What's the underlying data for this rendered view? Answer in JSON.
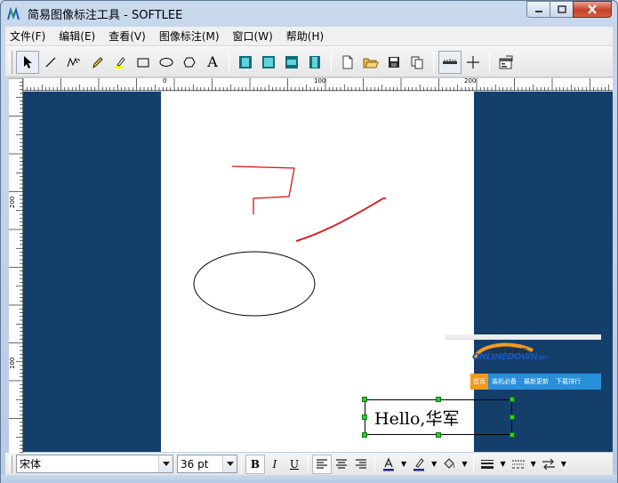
{
  "window": {
    "title": "简易图像标注工具 - SOFTLEE",
    "buttons": {
      "minimize": "minimize",
      "maximize": "maximize",
      "close": "close"
    }
  },
  "menubar": {
    "items": [
      {
        "label": "文件(F)"
      },
      {
        "label": "编辑(E)"
      },
      {
        "label": "查看(V)"
      },
      {
        "label": "图像标注(M)"
      },
      {
        "label": "窗口(W)"
      },
      {
        "label": "帮助(H)"
      }
    ]
  },
  "toolbar": {
    "tools": [
      {
        "name": "select-arrow-icon"
      },
      {
        "name": "line-icon"
      },
      {
        "name": "freehand-icon"
      },
      {
        "name": "pencil-icon"
      },
      {
        "name": "highlighter-icon"
      },
      {
        "name": "rectangle-icon"
      },
      {
        "name": "ellipse-icon"
      },
      {
        "name": "polygon-icon"
      },
      {
        "name": "text-icon",
        "label": "A"
      },
      {
        "name": "frame-style-1-icon"
      },
      {
        "name": "frame-style-2-icon"
      },
      {
        "name": "frame-style-3-icon"
      },
      {
        "name": "frame-style-4-icon"
      },
      {
        "name": "new-file-icon"
      },
      {
        "name": "open-folder-icon"
      },
      {
        "name": "save-icon"
      },
      {
        "name": "copy-icon"
      },
      {
        "name": "ruler-icon"
      },
      {
        "name": "crosshair-icon"
      },
      {
        "name": "properties-icon"
      }
    ]
  },
  "rulers": {
    "horizontal_labels": [
      "0",
      "100",
      "200"
    ],
    "vertical_labels": [
      "200",
      "100"
    ]
  },
  "canvas": {
    "snippet": {
      "logo_cn": "华军软件园",
      "logo_brand": "ONLINEDOWN",
      "logo_suffix": ".NET",
      "nav_items": [
        "首页",
        "装机必备",
        "最新更新",
        "下载排行"
      ]
    },
    "text_annotation": "Hello,华军",
    "colors": {
      "background": "#143f6b",
      "paper": "#ffffff",
      "freehand_stroke": "#e01010",
      "ellipse_stroke": "#000000",
      "handle": "#2ecc2e"
    }
  },
  "formatbar": {
    "font_name": "宋体",
    "font_size": "36 pt",
    "bold_label": "B",
    "italic_label": "I",
    "underline_label": "U",
    "font_color_label": "A"
  }
}
